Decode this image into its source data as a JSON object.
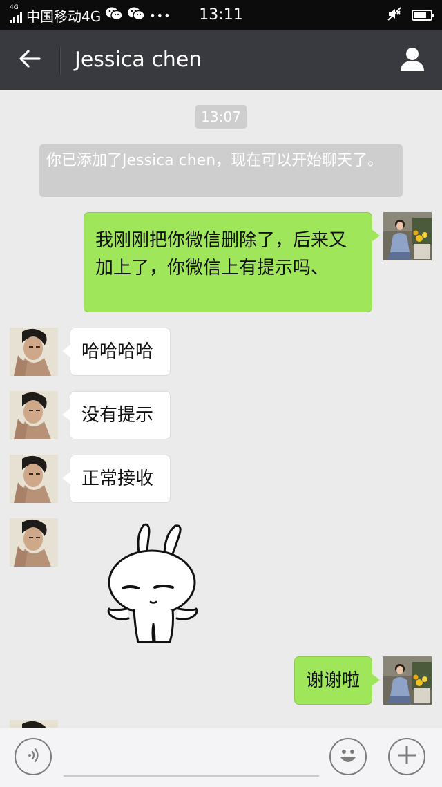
{
  "status_bar": {
    "network_type_small": "4G",
    "carrier": "中国移动4G",
    "extra_icons": [
      "wechat-icon",
      "wechat-icon",
      "more-dots-icon"
    ],
    "dots": "•••",
    "time": "13:11",
    "right_icons": [
      "mute-icon",
      "battery-icon"
    ],
    "battery_level": 0.75
  },
  "title_bar": {
    "title": "Jessica chen",
    "back_icon": "back-arrow-icon",
    "profile_icon": "person-icon"
  },
  "chat": {
    "timestamp": "13:07",
    "system_message": "你已添加了Jessica chen，现在可以开始聊天了。",
    "messages": [
      {
        "side": "out",
        "text": "我刚刚把你微信删除了，后来又加上了，你微信上有提示吗、"
      },
      {
        "side": "in",
        "text": "哈哈哈哈"
      },
      {
        "side": "in",
        "text": "没有提示"
      },
      {
        "side": "in",
        "text": "正常接收"
      },
      {
        "side": "in",
        "type": "sticker",
        "sticker": "rabbit-shrug-sticker"
      },
      {
        "side": "out",
        "text": "谢谢啦"
      }
    ]
  },
  "input_bar": {
    "voice_icon": "voice-icon",
    "emoji_icon": "emoji-icon",
    "plus_icon": "plus-icon",
    "input_value": ""
  },
  "colors": {
    "status_bar_bg": "#0c0c0c",
    "title_bar_bg": "#393a3f",
    "chat_bg": "#ebebeb",
    "outgoing_bubble": "#9fe65a",
    "incoming_bubble": "#ffffff"
  }
}
